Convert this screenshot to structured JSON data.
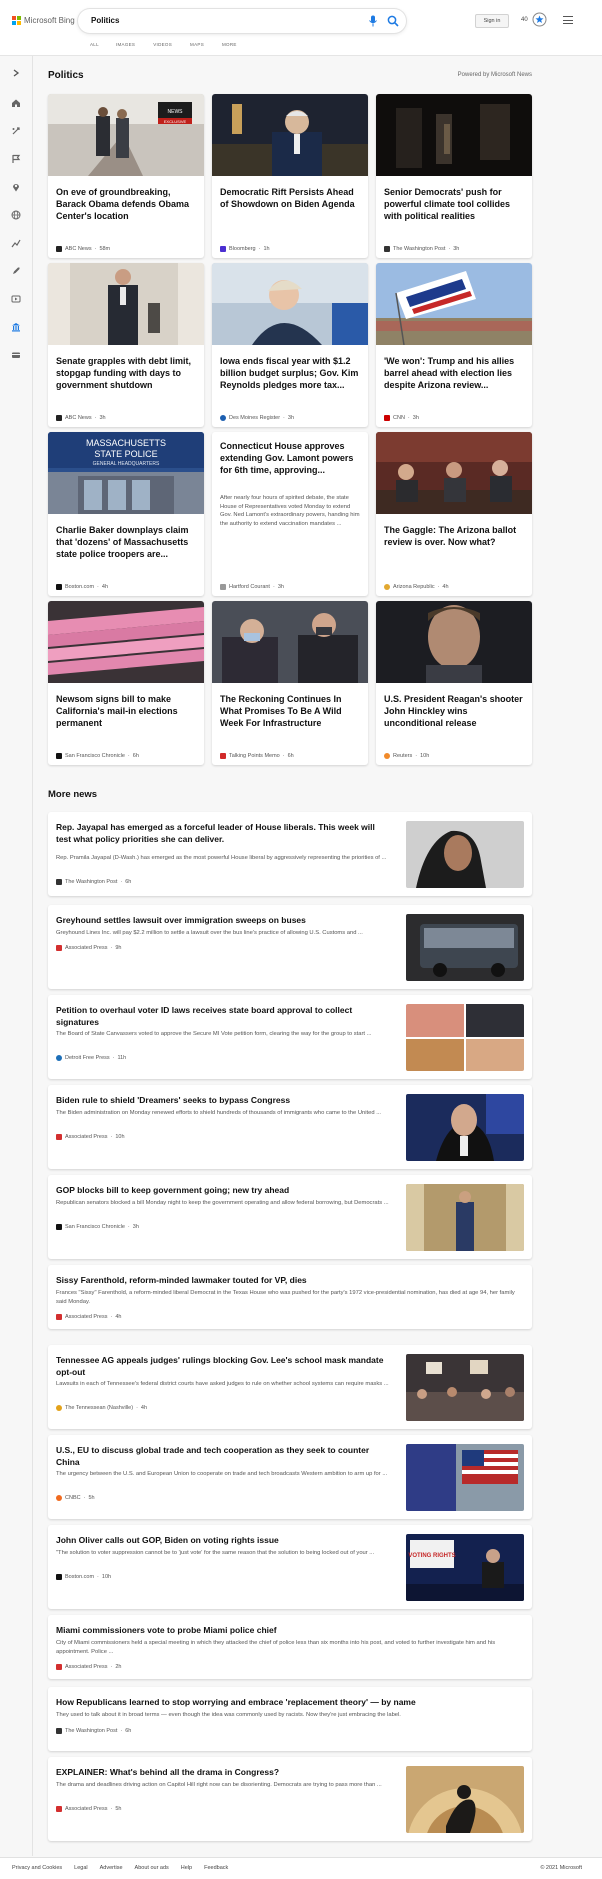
{
  "header": {
    "logo_text": "Microsoft Bing",
    "search_value": "Politics",
    "tabs": [
      "ALL",
      "IMAGES",
      "VIDEOS",
      "MAPS",
      "MORE"
    ],
    "signin_label": "Sign in",
    "points": "40"
  },
  "section": {
    "title": "Politics",
    "powered_by": "Powered by Microsoft News"
  },
  "cards": [
    {
      "title": "On eve of groundbreaking, Barack Obama defends Obama Center's location",
      "source": "ABC News",
      "time": "58m",
      "badge1": "NEWS",
      "badge2": "EXCLUSIVE"
    },
    {
      "title": "Democratic Rift Persists Ahead of Showdown on Biden Agenda",
      "source": "Bloomberg",
      "time": "1h"
    },
    {
      "title": "Senior Democrats' push for powerful climate tool collides with political realities",
      "source": "The Washington Post",
      "time": "3h"
    },
    {
      "title": "Senate grapples with debt limit, stopgap funding with days to government shutdown",
      "source": "ABC News",
      "time": "3h"
    },
    {
      "title": "Iowa ends fiscal year with $1.2 billion budget surplus; Gov. Kim Reynolds pledges more tax...",
      "source": "Des Moines Register",
      "time": "3h"
    },
    {
      "title": "'We won': Trump and his allies barrel ahead with election lies despite Arizona review...",
      "source": "CNN",
      "time": "3h"
    },
    {
      "title": "Charlie Baker downplays claim that 'dozens' of Massachusetts state police troopers are...",
      "source": "Boston.com",
      "time": "4h",
      "sign1": "MASSACHUSETTS",
      "sign2": "STATE POLICE",
      "sign3": "GENERAL HEADQUARTERS"
    },
    {
      "title": "Connecticut House approves extending Gov. Lamont powers for 6th time, approving...",
      "snippet": "After nearly four hours of spirited debate, the state House of Representatives voted Monday to extend Gov. Ned Lamont's extraordinary powers, handing him the authority to extend vaccination mandates ...",
      "source": "Hartford Courant",
      "time": "3h"
    },
    {
      "title": "The Gaggle: The Arizona ballot review is over. Now what?",
      "source": "Arizona Republic",
      "time": "4h"
    },
    {
      "title": "Newsom signs bill to make California's mail-in elections permanent",
      "source": "San Francisco Chronicle",
      "time": "6h"
    },
    {
      "title": "The Reckoning Continues In What Promises To Be A Wild Week For Infrastructure",
      "source": "Talking Points Memo",
      "time": "6h"
    },
    {
      "title": "U.S. President Reagan's shooter John Hinckley wins unconditional release",
      "source": "Reuters",
      "time": "10h"
    }
  ],
  "more_news": {
    "title": "More news",
    "items": [
      {
        "title": "Rep. Jayapal has emerged as a forceful leader of House liberals. This week will test what policy priorities she can deliver.",
        "snippet": "Rep. Pramila Jayapal (D-Wash.) has emerged as the most powerful House liberal by aggressively representing the priorities of ...",
        "source": "The Washington Post",
        "time": "6h"
      },
      {
        "title": "Greyhound settles lawsuit over immigration sweeps on buses",
        "snippet": "Greyhound Lines Inc. will pay $2.2 million to settle a lawsuit over the bus line's practice of allowing U.S. Customs and ...",
        "source": "Associated Press",
        "time": "9h"
      },
      {
        "title": "Petition to overhaul voter ID laws receives state board approval to collect signatures",
        "snippet": "The Board of State Canvassers voted to approve the Secure MI Vote petition form, clearing the way for the group to start ...",
        "source": "Detroit Free Press",
        "time": "11h"
      },
      {
        "title": "Biden rule to shield 'Dreamers' seeks to bypass Congress",
        "snippet": "The Biden administration on Monday renewed efforts to shield hundreds of thousands of immigrants who came to the United ...",
        "source": "Associated Press",
        "time": "10h"
      },
      {
        "title": "GOP blocks bill to keep government going; new try ahead",
        "snippet": "Republican senators blocked a bill Monday night to keep the government operating and allow federal borrowing, but Democrats ...",
        "source": "San Francisco Chronicle",
        "time": "3h"
      },
      {
        "title": "Sissy Farenthold, reform-minded lawmaker touted for VP, dies",
        "snippet": "Frances \"Sissy\" Farenthold, a reform-minded liberal Democrat in the Texas House who was pushed for the party's 1972 vice-presidential nomination, has died at age 94, her family said Monday.",
        "source": "Associated Press",
        "time": "4h"
      },
      {
        "title": "Tennessee AG appeals judges' rulings blocking Gov. Lee's school mask mandate opt-out",
        "snippet": "Lawsuits in each of Tennessee's federal district courts have asked judges to rule on whether school systems can require masks ...",
        "source": "The Tennessean (Nashville)",
        "time": "4h"
      },
      {
        "title": "U.S., EU to discuss global trade and tech cooperation as they seek to counter China",
        "snippet": "The urgency between the U.S. and European Union to cooperate on trade and tech broadcasts Western ambition to arm up for ...",
        "source": "CNBC",
        "time": "5h"
      },
      {
        "title": "John Oliver calls out GOP, Biden on voting rights issue",
        "snippet": "\"The solution to voter suppression cannot be to 'just vote' for the same reason that the solution to being locked out of your ...",
        "source": "Boston.com",
        "time": "10h",
        "thumb_sign": "VOTING RIGHTS"
      },
      {
        "title": "Miami commissioners vote to probe Miami police chief",
        "snippet": "City of Miami commissioners held a special meeting in which they attacked the chief of police less than six months into his post, and voted to further investigate him and his appointment. Police ...",
        "source": "Associated Press",
        "time": "2h"
      },
      {
        "title": "How Republicans learned to stop worrying and embrace 'replacement theory' — by name",
        "snippet": "They used to talk about it in broad terms — even though the idea was commonly used by racists. Now they're just embracing the label.",
        "source": "The Washington Post",
        "time": "6h"
      },
      {
        "title": "EXPLAINER: What's behind all the drama in Congress?",
        "snippet": "The drama and deadlines driving action on Capitol Hill right now can be disorienting. Democrats are trying to pass more than ...",
        "source": "Associated Press",
        "time": "5h"
      }
    ]
  },
  "footer": {
    "links": [
      "Privacy and Cookies",
      "Legal",
      "Advertise",
      "About our ads",
      "Help",
      "Feedback"
    ],
    "copyright": "© 2021 Microsoft"
  },
  "colors": {
    "accent": "#0067b8",
    "bing_blue": "#1d7ae3",
    "ms_red": "#f25022",
    "ms_green": "#7fba00",
    "ms_blue": "#00a4ef",
    "ms_yellow": "#ffb900"
  }
}
